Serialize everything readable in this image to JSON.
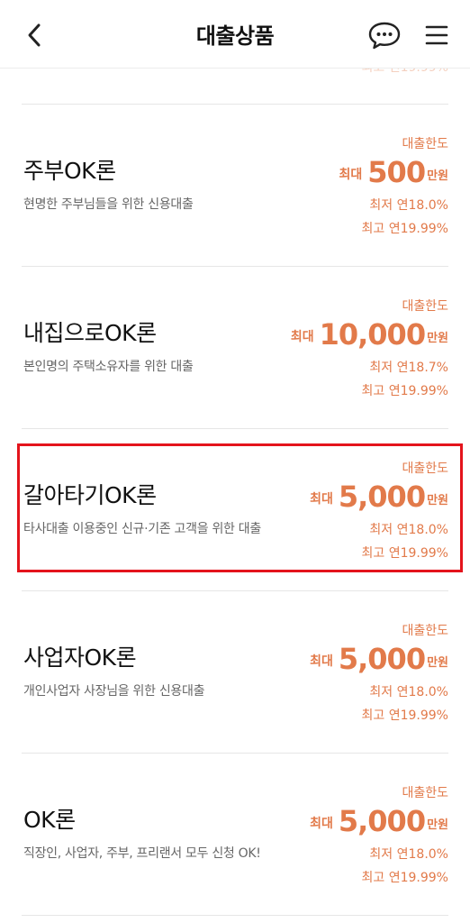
{
  "header": {
    "title": "대출상품",
    "back_icon": "chevron-left-icon",
    "chat_icon": "chat-bubble-icon",
    "menu_icon": "hamburger-menu-icon"
  },
  "peek_text": "최고 연19.99%",
  "products": [
    {
      "name": "주부OK론",
      "desc": "현명한 주부님들을 위한 신용대출",
      "limit_label": "대출한도",
      "amount_prefix": "최대",
      "amount_value": "500",
      "amount_unit": "만원",
      "rate_min": "최저 연18.0%",
      "rate_max": "최고 연19.99%"
    },
    {
      "name": "내집으로OK론",
      "desc": "본인명의 주택소유자를 위한 대출",
      "limit_label": "대출한도",
      "amount_prefix": "최대",
      "amount_value": "10,000",
      "amount_unit": "만원",
      "rate_min": "최저 연18.7%",
      "rate_max": "최고 연19.99%"
    },
    {
      "name": "갈아타기OK론",
      "desc": "타사대출 이용중인 신규·기존 고객을 위한 대출",
      "limit_label": "대출한도",
      "amount_prefix": "최대",
      "amount_value": "5,000",
      "amount_unit": "만원",
      "rate_min": "최저 연18.0%",
      "rate_max": "최고 연19.99%"
    },
    {
      "name": "사업자OK론",
      "desc": "개인사업자 사장님을 위한 신용대출",
      "limit_label": "대출한도",
      "amount_prefix": "최대",
      "amount_value": "5,000",
      "amount_unit": "만원",
      "rate_min": "최저 연18.0%",
      "rate_max": "최고 연19.99%"
    },
    {
      "name": "OK론",
      "desc": "직장인, 사업자, 주부, 프리랜서 모두 신청 OK!",
      "limit_label": "대출한도",
      "amount_prefix": "최대",
      "amount_value": "5,000",
      "amount_unit": "만원",
      "rate_min": "최저 연18.0%",
      "rate_max": "최고 연19.99%"
    }
  ],
  "colors": {
    "accent": "#e27a4a",
    "highlight_border": "#e4141c",
    "divider": "#e6e6e6"
  }
}
